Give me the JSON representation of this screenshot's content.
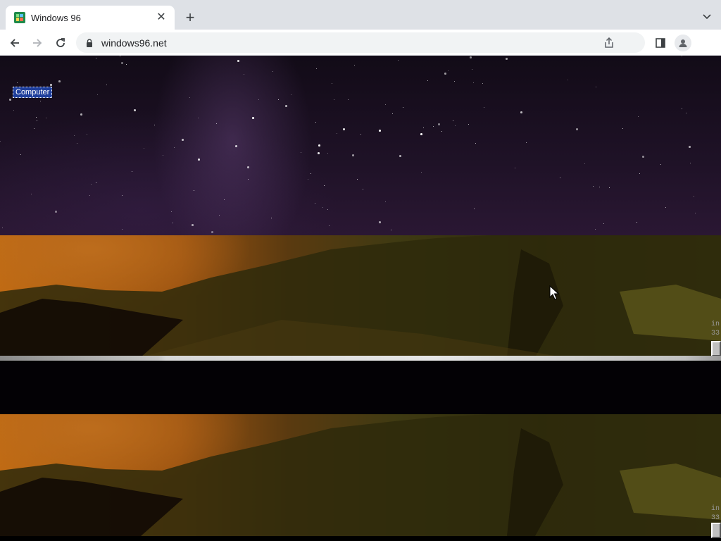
{
  "browser": {
    "tab": {
      "title": "Windows 96",
      "favicon": "windows-logo-icon",
      "close_icon": "close-icon"
    },
    "new_tab_icon": "plus-icon",
    "tab_search_icon": "chevron-down-icon",
    "toolbar": {
      "back_icon": "back-arrow-icon",
      "forward_icon": "forward-arrow-icon",
      "reload_icon": "reload-icon",
      "address": "windows96.net",
      "lock_icon": "lock-icon",
      "share_icon": "share-icon",
      "side_panel_icon": "side-panel-icon",
      "profile_icon": "profile-avatar-icon"
    }
  },
  "desktop": {
    "icons": [
      {
        "label": "Computer",
        "selected": true
      }
    ],
    "edge_text_top": [
      "in",
      "33"
    ],
    "edge_text_bottom": [
      "in",
      "33"
    ]
  },
  "colors": {
    "tabstrip_bg": "#dee1e6",
    "selection_blue": "#1f3f9c"
  }
}
